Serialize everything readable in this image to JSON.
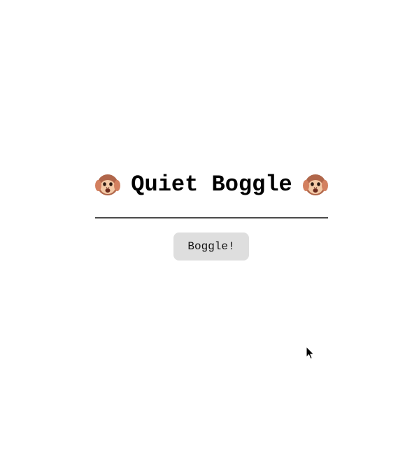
{
  "header": {
    "title": "Quiet Boggle",
    "left_icon": "hear-no-evil-monkey-icon",
    "right_icon": "hear-no-evil-monkey-icon"
  },
  "actions": {
    "boggle_button_label": "Boggle!"
  },
  "colors": {
    "background": "#ffffff",
    "title": "#000000",
    "divider": "#4a4a4a",
    "button_bg": "#dedede",
    "monkey_fur": "#b0664a",
    "monkey_face": "#f3c9a6"
  },
  "cursor": {
    "icon": "mouse-pointer-icon"
  }
}
